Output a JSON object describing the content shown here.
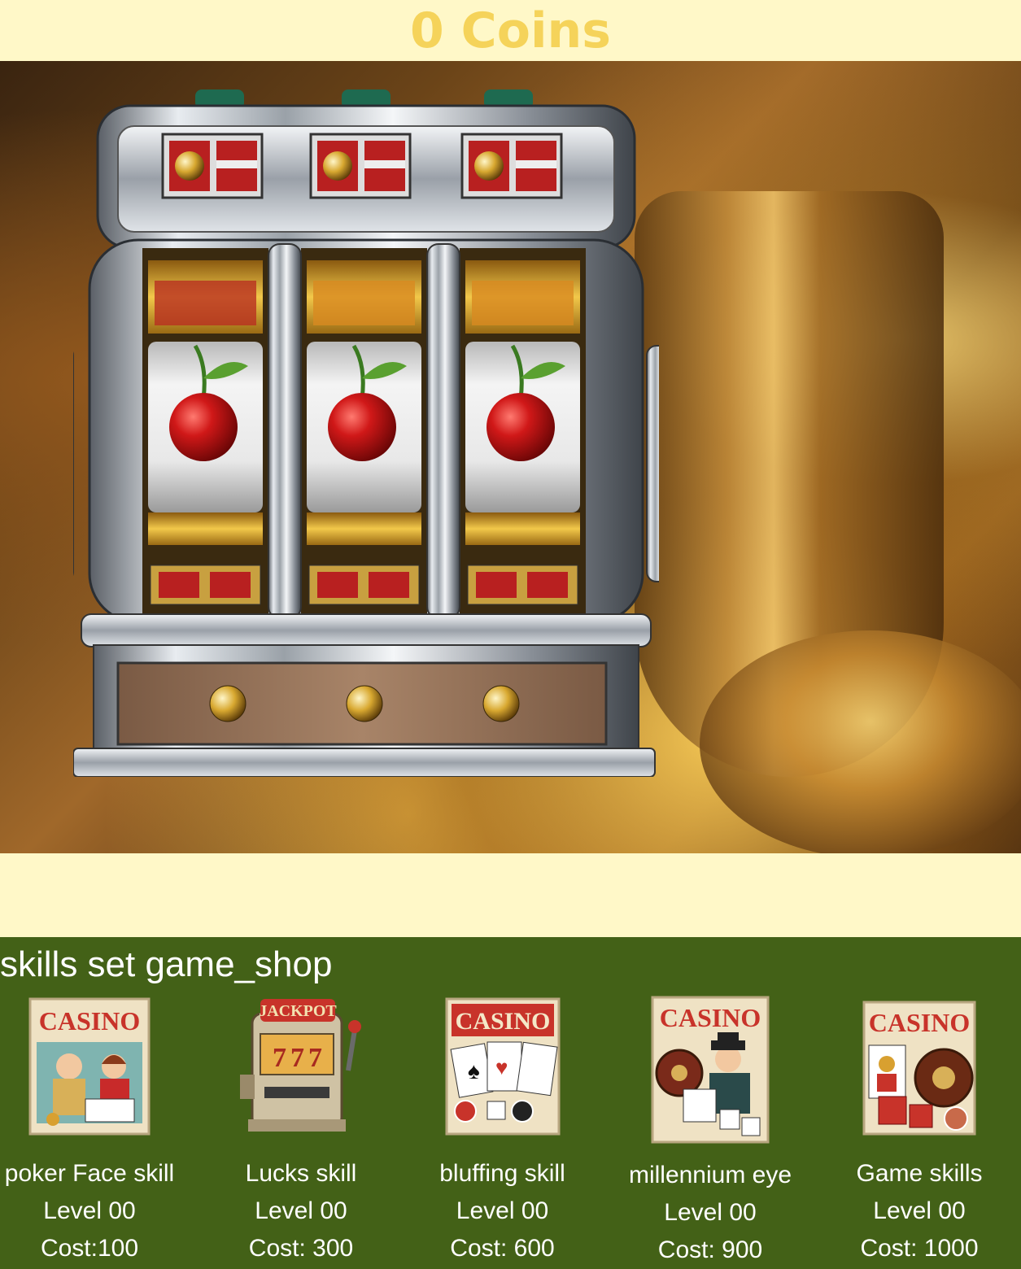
{
  "header": {
    "coins_text": "0 Coins"
  },
  "slot_machine": {
    "symbols": [
      "cherry",
      "cherry",
      "cherry"
    ]
  },
  "shop": {
    "title": "skills set game_shop",
    "items": [
      {
        "name": "poker Face skill",
        "level": "Level 00",
        "cost": "Cost:100",
        "poster_text": "CASINO",
        "icon": "casino-poker-couple-poster-icon"
      },
      {
        "name": "Lucks skill",
        "level": "Level 00",
        "cost": "Cost: 300",
        "poster_text": "JACKPOT",
        "icon": "jackpot-slot-machine-icon"
      },
      {
        "name": "bluffing skill",
        "level": "Level 00",
        "cost": "Cost: 600",
        "poster_text": "CASINO",
        "icon": "casino-cards-chips-poster-icon"
      },
      {
        "name": "millennium eye",
        "level": "Level 00",
        "cost": "Cost: 900",
        "poster_text": "CASINO",
        "icon": "casino-gambler-poster-icon"
      },
      {
        "name": "Game skills",
        "level": "Level 00",
        "cost": "Cost: 1000",
        "poster_text": "CASINO",
        "icon": "casino-roulette-dice-poster-icon"
      }
    ]
  },
  "colors": {
    "coins": "#f5d35a",
    "page_bg": "#fff8c8",
    "shop_bg": "#436117"
  }
}
